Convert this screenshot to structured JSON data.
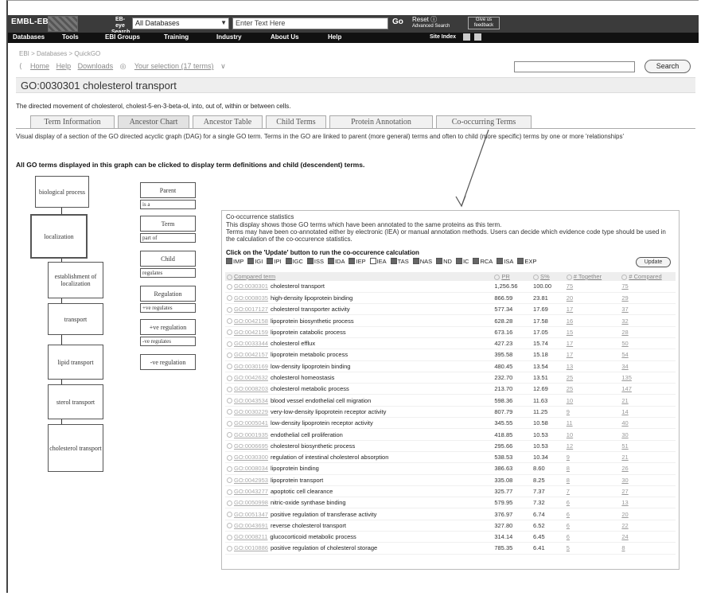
{
  "header": {
    "logo": "EMBL-EBI",
    "search_logo": "EB-eye Search",
    "db_select": "All Databases",
    "search_placeholder": "Enter Text Here",
    "go": "Go",
    "reset": "Reset",
    "advanced": "Advanced Search",
    "feedback": "Give us feedback"
  },
  "nav": {
    "items": [
      "Databases",
      "Tools",
      "EBI Groups",
      "Training",
      "Industry",
      "About Us",
      "Help"
    ],
    "site_index": "Site Index"
  },
  "breadcrumb": "EBI > Databases > QuickGO",
  "links": {
    "home": "Home",
    "help": "Help",
    "downloads": "Downloads",
    "selection": "Your selection (17 terms)"
  },
  "search_button": "Search",
  "term": {
    "title": "GO:0030301 cholesterol transport",
    "description": "The directed movement of cholesterol, cholest-5-en-3-beta-ol, into, out of, within or between cells."
  },
  "tabs": [
    "Term Information",
    "Ancestor Chart",
    "Ancestor Table",
    "Child Terms",
    "Protein Annotation",
    "Co-occurring Terms"
  ],
  "visual_text": "Visual display of a section of the GO directed acyclic graph (DAG) for a single GO term. Terms in the GO are linked to parent (more general) terms and often to child (more specific) terms by one or more 'relationships'",
  "bold_text": "All GO terms displayed in this graph can be clicked to display term definitions and child (descendent) terms.",
  "graph": {
    "nodes": [
      "biological process",
      "localization",
      "establishment of localization",
      "transport",
      "lipid transport",
      "sterol transport",
      "cholesterol transport"
    ]
  },
  "legend": {
    "parent": "Parent",
    "is_a": "is a",
    "term": "Term",
    "part_of": "part of",
    "child": "Child",
    "regulates": "regulates",
    "regulation": "Regulation",
    "pos_regulates": "+ve regulates",
    "pos_regulation": "+ve regulation",
    "neg_regulates": "-ve regulates",
    "neg_regulation": "-ve regulation"
  },
  "cooc": {
    "title": "Co-occurrence statistics",
    "text1": "This display shows those GO terms which have been annotated to the same proteins as this term.",
    "text2": "Terms may have been co-annotated either by electronic (IEA) or manual annotation methods. Users can decide which evidence code type should be used in the calculation of the co-occurence statistics.",
    "bold": "Click on the 'Update' button to run the co-occurence calculation",
    "codes": [
      {
        "code": "IMP",
        "checked": true
      },
      {
        "code": "IGI",
        "checked": true
      },
      {
        "code": "IPI",
        "checked": true
      },
      {
        "code": "IGC",
        "checked": true
      },
      {
        "code": "ISS",
        "checked": true
      },
      {
        "code": "IDA",
        "checked": true
      },
      {
        "code": "IEP",
        "checked": true
      },
      {
        "code": "IEA",
        "checked": false
      },
      {
        "code": "TAS",
        "checked": true
      },
      {
        "code": "NAS",
        "checked": true
      },
      {
        "code": "ND",
        "checked": true
      },
      {
        "code": "IC",
        "checked": true
      },
      {
        "code": "RCA",
        "checked": true
      },
      {
        "code": "ISA",
        "checked": true
      },
      {
        "code": "EXP",
        "checked": true
      }
    ],
    "update": "Update",
    "columns": [
      "Compared term",
      "PR",
      "S%",
      "# Together",
      "# Compared"
    ],
    "rows": [
      [
        "GO:0030301",
        "cholesterol transport",
        "1,256.56",
        "100.00",
        "75",
        "75"
      ],
      [
        "GO:0008035",
        "high-density lipoprotein binding",
        "866.59",
        "23.81",
        "20",
        "29"
      ],
      [
        "GO:0017127",
        "cholesterol transporter activity",
        "577.34",
        "17.69",
        "17",
        "37"
      ],
      [
        "GO:0042158",
        "lipoprotein biosynthetic process",
        "628.28",
        "17.58",
        "16",
        "32"
      ],
      [
        "GO:0042159",
        "lipoprotein catabolic process",
        "673.16",
        "17.05",
        "15",
        "28"
      ],
      [
        "GO:0033344",
        "cholesterol efflux",
        "427.23",
        "15.74",
        "17",
        "50"
      ],
      [
        "GO:0042157",
        "lipoprotein metabolic process",
        "395.58",
        "15.18",
        "17",
        "54"
      ],
      [
        "GO:0030169",
        "low-density lipoprotein binding",
        "480.45",
        "13.54",
        "13",
        "34"
      ],
      [
        "GO:0042632",
        "cholesterol homeostasis",
        "232.70",
        "13.51",
        "25",
        "135"
      ],
      [
        "GO:0008203",
        "cholesterol metabolic process",
        "213.70",
        "12.69",
        "25",
        "147"
      ],
      [
        "GO:0043534",
        "blood vessel endothelial cell migration",
        "598.36",
        "11.63",
        "10",
        "21"
      ],
      [
        "GO:0030229",
        "very-low-density lipoprotein receptor activity",
        "807.79",
        "11.25",
        "9",
        "14"
      ],
      [
        "GO:0005041",
        "low-density lipoprotein receptor activity",
        "345.55",
        "10.58",
        "11",
        "40"
      ],
      [
        "GO:0001935",
        "endothelial cell proliferation",
        "418.85",
        "10.53",
        "10",
        "30"
      ],
      [
        "GO:0006695",
        "cholesterol biosynthetic process",
        "295.66",
        "10.53",
        "12",
        "51"
      ],
      [
        "GO:0030300",
        "regulation of intestinal cholesterol absorption",
        "538.53",
        "10.34",
        "9",
        "21"
      ],
      [
        "GO:0008034",
        "lipoprotein binding",
        "386.63",
        "8.60",
        "8",
        "26"
      ],
      [
        "GO:0042953",
        "lipoprotein transport",
        "335.08",
        "8.25",
        "8",
        "30"
      ],
      [
        "GO:0043277",
        "apoptotic cell clearance",
        "325.77",
        "7.37",
        "7",
        "27"
      ],
      [
        "GO:0050998",
        "nitric-oxide synthase binding",
        "579.95",
        "7.32",
        "6",
        "13"
      ],
      [
        "GO:0051347",
        "positive regulation of transferase activity",
        "376.97",
        "6.74",
        "6",
        "20"
      ],
      [
        "GO:0043691",
        "reverse cholesterol transport",
        "327.80",
        "6.52",
        "6",
        "22"
      ],
      [
        "GO:0008211",
        "glucocorticoid metabolic process",
        "314.14",
        "6.45",
        "6",
        "24"
      ],
      [
        "GO:0010886",
        "positive regulation of cholesterol storage",
        "785.35",
        "6.41",
        "5",
        "8"
      ]
    ]
  }
}
